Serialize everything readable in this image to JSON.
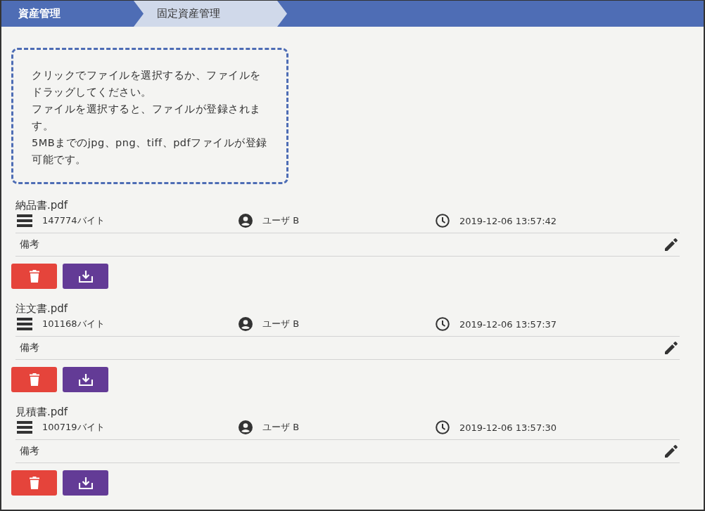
{
  "breadcrumb": [
    {
      "label": "資産管理",
      "selected": false
    },
    {
      "label": "固定資産管理",
      "selected": true
    }
  ],
  "upload_area": {
    "paragraphs": [
      "クリックでファイルを選択するか、ファイルをドラッグしてください。",
      "ファイルを選択すると、ファイルが登録されます。",
      "5MBまでのjpg、png、tiff、pdfファイルが登録可能です。"
    ]
  },
  "files": [
    {
      "name": "納品書.pdf",
      "size": "147774バイト",
      "user": "ユーザ B",
      "timestamp": "2019-12-06 13:57:42",
      "remark_label": "備考"
    },
    {
      "name": "注文書.pdf",
      "size": "101168バイト",
      "user": "ユーザ B",
      "timestamp": "2019-12-06 13:57:37",
      "remark_label": "備考"
    },
    {
      "name": "見積書.pdf",
      "size": "100719バイト",
      "user": "ユーザ B",
      "timestamp": "2019-12-06 13:57:30",
      "remark_label": "備考"
    }
  ]
}
